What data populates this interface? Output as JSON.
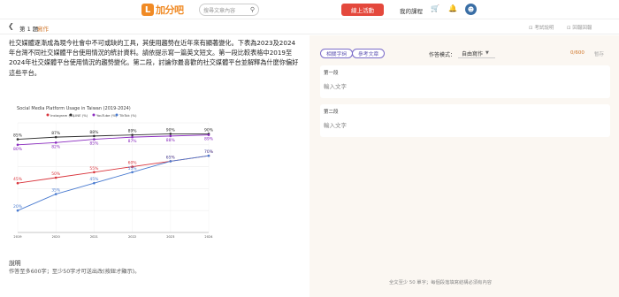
{
  "header": {
    "logo_mark": "L",
    "logo_text": "加分吧",
    "search_placeholder": "搜尋文章內容",
    "live_button": "線上活動",
    "my_courses": "我的課程"
  },
  "subheader": {
    "question_number": "第 1 題",
    "question_type": "寫作",
    "link1": "⊡ 考試說明",
    "link2": "⊡ 回報回報"
  },
  "prompt": {
    "text": "社交媒體逐漸成為現今社會中不可或缺的工具，其使用趨勢在近年來有顯著變化。下表為2023及2024年台灣不同社交媒體平台使用情況的統計資料。請依提示寫一篇英文短文。第一段比較表格中2019至2024年社交媒體平台使用情況的趨勢變化。第二段，討論你最喜歡的社交媒體平台並解釋為什麼你偏好這些平台。"
  },
  "explain": {
    "title": "說明",
    "text": "作答至多600字；至少50字才可送出改(按鈕才顯示)。"
  },
  "right": {
    "btn_hint": "相關字詞",
    "btn_ref": "參考文章",
    "mode_label": "作答模式：",
    "mode_value": "自由寫作",
    "count": "0/600",
    "save": "暫存",
    "para1_label": "第一段",
    "para1_placeholder": "輸入文字",
    "para2_label": "第二段",
    "para2_placeholder": "輸入文字",
    "footer": "全文至少 50 單字；每個段落填寫結構必須有內容"
  },
  "chart_data": {
    "type": "line",
    "title": "Social Media Platform Usage in Taiwan (2019-2024)",
    "x": [
      "2019",
      "2020",
      "2021",
      "2022",
      "2023",
      "2024"
    ],
    "ylim": [
      0,
      100
    ],
    "series": [
      {
        "name": "Instagram (%)",
        "color": "#d9343c",
        "values": [
          45,
          50,
          55,
          60,
          65,
          70
        ],
        "labels": [
          "45%",
          "50%",
          "55%",
          "60%",
          "65%",
          "70%"
        ]
      },
      {
        "name": "LINE (%)",
        "color": "#2f2f2f",
        "values": [
          85,
          87,
          88,
          89,
          90,
          90
        ],
        "labels": [
          "85%",
          "87%",
          "88%",
          "89%",
          "90%",
          "90%"
        ]
      },
      {
        "name": "YouTube (%)",
        "color": "#8a2bbf",
        "values": [
          80,
          82,
          85,
          87,
          88,
          89
        ],
        "labels": [
          "80%",
          "82%",
          "85%",
          "87%",
          "88%",
          "89%"
        ]
      },
      {
        "name": "TikTok (%)",
        "color": "#4a7bd0",
        "values": [
          20,
          35,
          45,
          55,
          65,
          70
        ],
        "labels": [
          "20%",
          "35%",
          "45%",
          "55%",
          "65%",
          "70%"
        ]
      }
    ],
    "grid": true,
    "legend": "top"
  }
}
